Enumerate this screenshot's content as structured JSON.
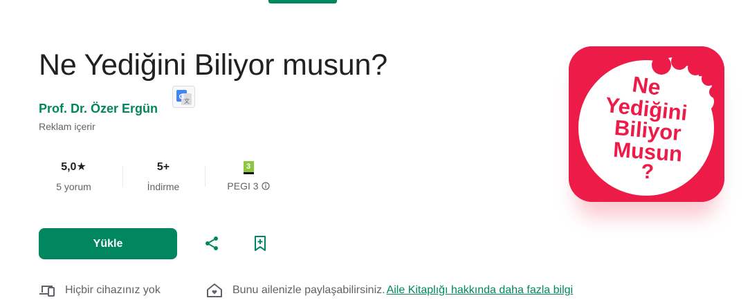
{
  "app": {
    "title": "Ne Yediğini Biliyor musun?",
    "developer": "Prof. Dr. Özer Ergün",
    "ads_note": "Reklam içerir",
    "icon_lines": [
      "Ne",
      "Yediğini",
      "Biliyor",
      "Musun",
      "?"
    ]
  },
  "stats": {
    "rating_value": "5,0★",
    "rating_label": "5 yorum",
    "downloads_value": "5+",
    "downloads_label": "İndirme",
    "pegi_badge": "3",
    "pegi_label": "PEGI 3"
  },
  "actions": {
    "install_label": "Yükle"
  },
  "footer": {
    "devices_text": "Hiçbir cihazınız yok",
    "family_text": "Bunu ailenizle paylaşabilirsiniz.",
    "family_link": "Aile Kitaplığı hakkında daha fazla bilgi"
  },
  "colors": {
    "accent": "#01875f",
    "icon_background": "#ed1b47",
    "text_primary": "#202124",
    "text_secondary": "#5f6368"
  },
  "icons": {
    "translate": "google-translate-icon",
    "share": "share-icon",
    "wishlist": "bookmark-add-icon",
    "devices": "devices-icon",
    "family": "family-home-icon",
    "info": "info-icon"
  }
}
